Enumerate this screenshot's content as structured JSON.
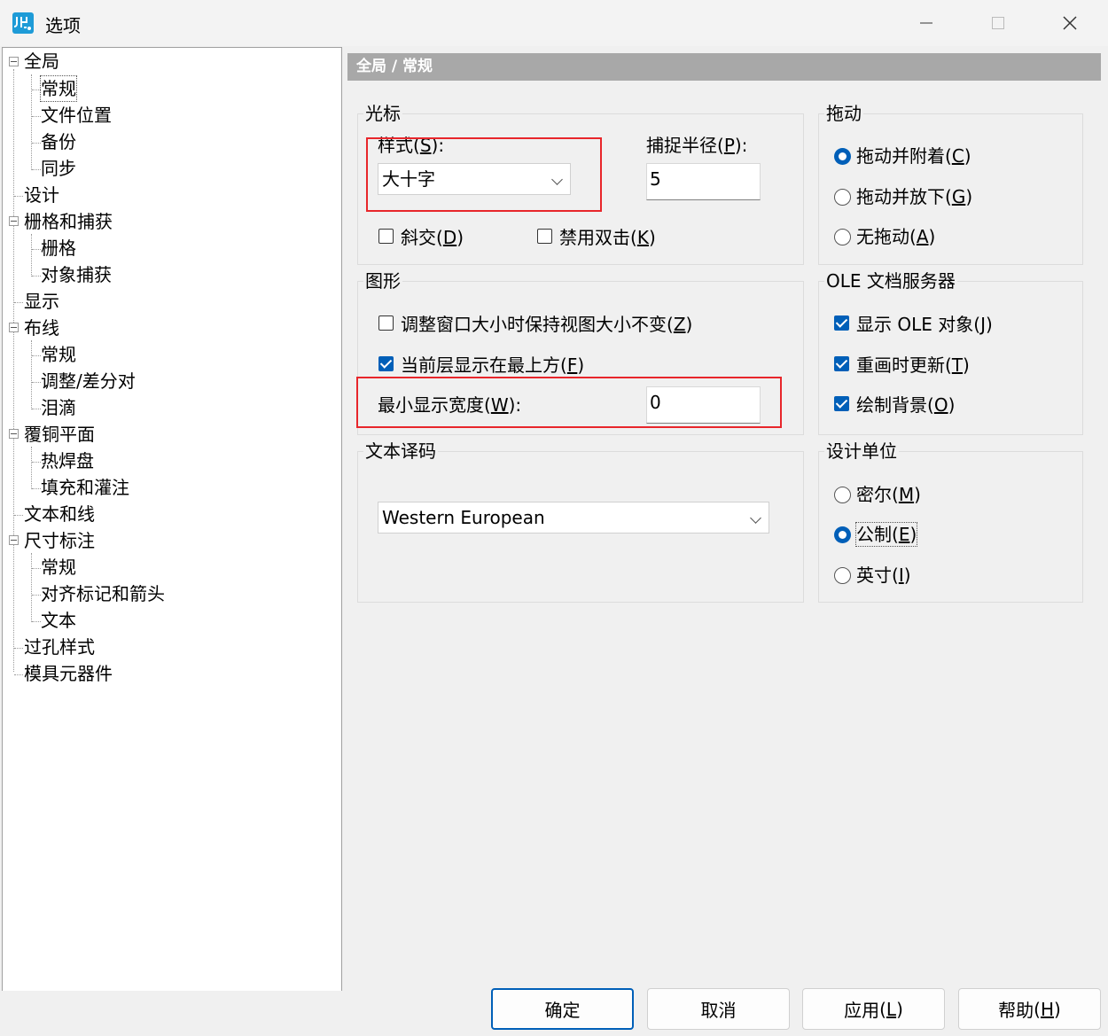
{
  "window": {
    "title": "选项"
  },
  "tree": {
    "items": [
      {
        "label": "全局"
      },
      {
        "label": "常规"
      },
      {
        "label": "文件位置"
      },
      {
        "label": "备份"
      },
      {
        "label": "同步"
      },
      {
        "label": "设计"
      },
      {
        "label": "栅格和捕获"
      },
      {
        "label": "栅格"
      },
      {
        "label": "对象捕获"
      },
      {
        "label": "显示"
      },
      {
        "label": "布线"
      },
      {
        "label": "常规"
      },
      {
        "label": "调整/差分对"
      },
      {
        "label": "泪滴"
      },
      {
        "label": "覆铜平面"
      },
      {
        "label": "热焊盘"
      },
      {
        "label": "填充和灌注"
      },
      {
        "label": "文本和线"
      },
      {
        "label": "尺寸标注"
      },
      {
        "label": "常规"
      },
      {
        "label": "对齐标记和箭头"
      },
      {
        "label": "文本"
      },
      {
        "label": "过孔样式"
      },
      {
        "label": "模具元器件"
      }
    ]
  },
  "page": {
    "header": "全局 / 常规"
  },
  "cursor": {
    "title": "光标",
    "style_label": "样式",
    "style_key": "S",
    "style_value": "大十字",
    "snap_label": "捕捉半径",
    "snap_key": "P",
    "snap_value": "5",
    "diagonal_label": "斜交",
    "diagonal_key": "D",
    "diagonal_checked": false,
    "no_dblclick_label": "禁用双击",
    "no_dblclick_key": "K",
    "no_dblclick_checked": false
  },
  "drag": {
    "title": "拖动",
    "options": [
      {
        "label": "拖动并附着",
        "key": "C",
        "checked": true
      },
      {
        "label": "拖动并放下",
        "key": "G",
        "checked": false
      },
      {
        "label": "无拖动",
        "key": "A",
        "checked": false
      }
    ]
  },
  "graphics": {
    "title": "图形",
    "keep_view_label": "调整窗口大小时保持视图大小不变",
    "keep_view_key": "Z",
    "keep_view_checked": false,
    "layer_top_label": "当前层显示在最上方",
    "layer_top_key": "F",
    "layer_top_checked": true,
    "min_width_label": "最小显示宽度",
    "min_width_key": "W",
    "min_width_value": "0"
  },
  "ole": {
    "title": "OLE 文档服务器",
    "options": [
      {
        "label": "显示 OLE 对象",
        "key": "J",
        "checked": true
      },
      {
        "label": "重画时更新",
        "key": "T",
        "checked": true
      },
      {
        "label": "绘制背景",
        "key": "O",
        "checked": true
      }
    ]
  },
  "encoding": {
    "title": "文本译码",
    "value": "Western European"
  },
  "units": {
    "title": "设计单位",
    "options": [
      {
        "label": "密尔",
        "key": "M",
        "checked": false
      },
      {
        "label": "公制",
        "key": "E",
        "checked": true
      },
      {
        "label": "英寸",
        "key": "I",
        "checked": false
      }
    ]
  },
  "buttons": {
    "ok": "确定",
    "cancel": "取消",
    "apply_label": "应用",
    "apply_key": "L",
    "help_label": "帮助",
    "help_key": "H"
  },
  "colors": {
    "accent": "#005fb8",
    "annotation": "#e8262b",
    "header_bg": "#a8a8a8"
  }
}
